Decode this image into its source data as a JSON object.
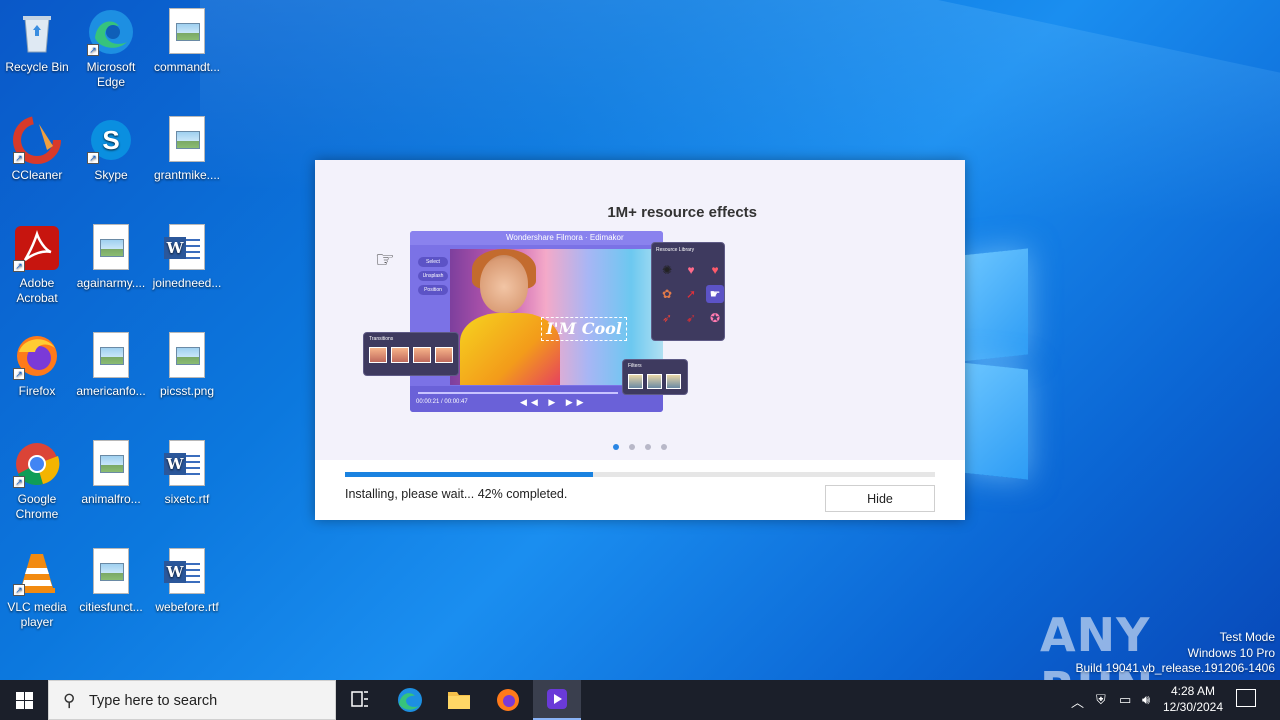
{
  "desktop": {
    "icons": [
      {
        "label": "Recycle Bin",
        "icon": "recycle-bin-icon"
      },
      {
        "label": "Microsoft Edge",
        "icon": "edge-icon"
      },
      {
        "label": "commandt...",
        "icon": "image-file-icon"
      },
      {
        "label": "CCleaner",
        "icon": "ccleaner-icon"
      },
      {
        "label": "Skype",
        "icon": "skype-icon"
      },
      {
        "label": "grantmike....",
        "icon": "image-file-icon"
      },
      {
        "label": "Adobe Acrobat",
        "icon": "acrobat-icon"
      },
      {
        "label": "againarmy....",
        "icon": "image-file-icon"
      },
      {
        "label": "joinedneed...",
        "icon": "word-doc-icon"
      },
      {
        "label": "Firefox",
        "icon": "firefox-icon"
      },
      {
        "label": "americanfo...",
        "icon": "image-file-icon"
      },
      {
        "label": "picsst.png",
        "icon": "image-file-icon"
      },
      {
        "label": "Google Chrome",
        "icon": "chrome-icon"
      },
      {
        "label": "animalfro...",
        "icon": "image-file-icon"
      },
      {
        "label": "sixetc.rtf",
        "icon": "word-doc-icon"
      },
      {
        "label": "VLC media player",
        "icon": "vlc-icon"
      },
      {
        "label": "citiesfunct...",
        "icon": "image-file-icon"
      },
      {
        "label": "webefore.rtf",
        "icon": "word-doc-icon"
      }
    ]
  },
  "installer": {
    "headline": "1M+ resource effects",
    "preview": {
      "app_title": "Wondershare Filmora · Edimakor",
      "sidebar_buttons": [
        "Select",
        "Unsplash",
        "Position"
      ],
      "overlay_text": "I'M Cool",
      "resource_panel_title": "Resource Library",
      "transitions_title": "Transitions",
      "filters_title": "Filters",
      "timecode": "00:00:21 / 00:00:47"
    },
    "carousel": {
      "count": 4,
      "active_index": 0
    },
    "progress_percent": 42,
    "status_text": "Installing, please wait... 42% completed.",
    "hide_label": "Hide"
  },
  "watermark": {
    "text": "ANY RUN"
  },
  "system_info": {
    "line1": "Test Mode",
    "line2": "Windows 10 Pro",
    "line3": "Build 19041.vb_release.191206-1406"
  },
  "taskbar": {
    "search_placeholder": "Type here to search",
    "pinned": [
      "task-view-icon",
      "edge-icon",
      "file-explorer-icon",
      "firefox-icon",
      "installer-app-icon"
    ],
    "clock_time": "4:28 AM",
    "clock_date": "12/30/2024"
  },
  "colors": {
    "accent": "#1a82e0",
    "taskbar": "#1b1f2a",
    "desktop": "#0c78de"
  }
}
